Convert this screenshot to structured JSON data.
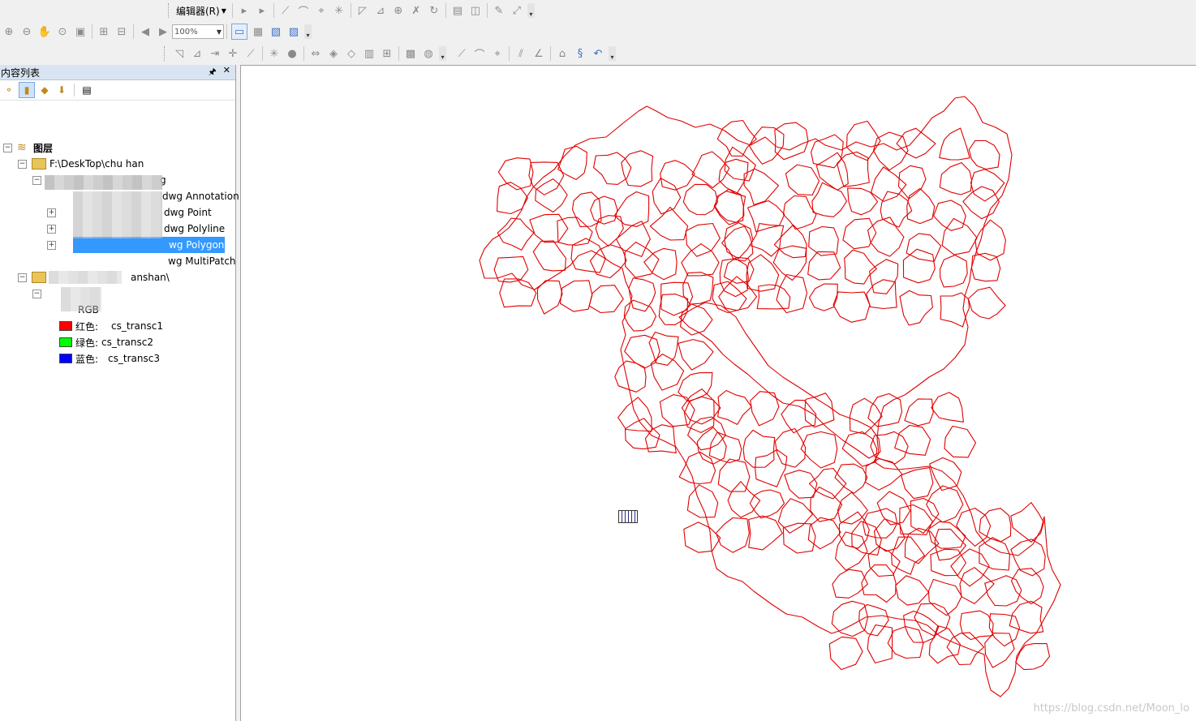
{
  "toolbar": {
    "editor_label": "编辑器(R)",
    "zoom_value": "100%"
  },
  "toc": {
    "title": "内容列表",
    "pin": "ᵖ",
    "close": "✕",
    "root": "图层",
    "folder1": "F:\\DeskTop\\chu  han",
    "dwg_suffix": "g",
    "dwg_annotation": "dwg Annotation",
    "dwg_point": "dwg Point",
    "dwg_polyline": "dwg Polyline",
    "dwg_polygon": "wg Polygon",
    "dwg_multipatch": "wg MultiPatch",
    "folder2_suffix": "anshan\\",
    "rgb_label": "RGB",
    "bands": [
      {
        "label": "红色:",
        "name": "cs_transc1",
        "color": "#ff0000"
      },
      {
        "label": "绿色:",
        "name": "cs_transc2",
        "color": "#00ff00"
      },
      {
        "label": "蓝色:",
        "name": "cs_transc3",
        "color": "#0000ff"
      }
    ]
  },
  "map": {
    "line_color": "#e00000",
    "watermark": "https://blog.csdn.net/Moon_lo"
  }
}
